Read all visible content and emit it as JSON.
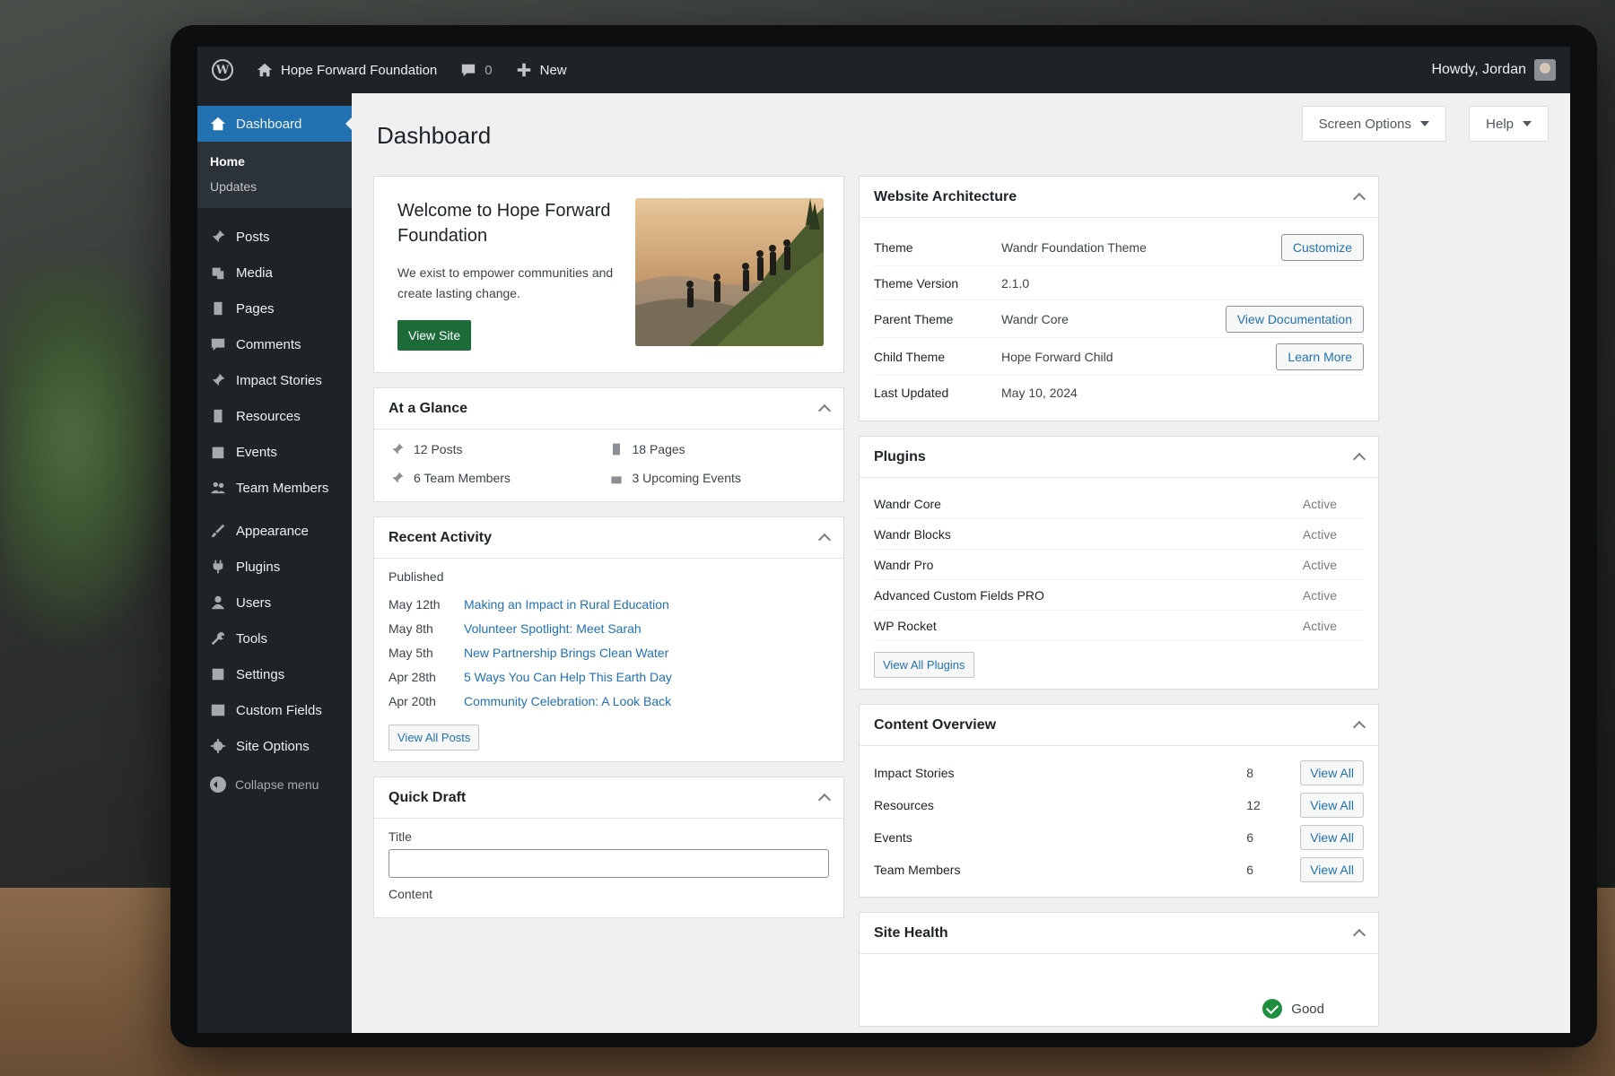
{
  "adminbar": {
    "site_name": "Hope Forward Foundation",
    "comments_count": "0",
    "new_label": "New",
    "greeting": "Howdy, Jordan"
  },
  "sidebar": {
    "dashboard": "Dashboard",
    "sub_home": "Home",
    "sub_updates": "Updates",
    "items": [
      {
        "label": "Posts",
        "icon": "pin-icon"
      },
      {
        "label": "Media",
        "icon": "media-icon"
      },
      {
        "label": "Pages",
        "icon": "pages-icon"
      },
      {
        "label": "Comments",
        "icon": "comments-icon"
      },
      {
        "label": "Impact Stories",
        "icon": "pin-icon"
      },
      {
        "label": "Resources",
        "icon": "pages-icon"
      },
      {
        "label": "Events",
        "icon": "calendar-icon"
      },
      {
        "label": "Team Members",
        "icon": "users-icon"
      }
    ],
    "items2": [
      {
        "label": "Appearance",
        "icon": "brush-icon"
      },
      {
        "label": "Plugins",
        "icon": "plug-icon"
      },
      {
        "label": "Users",
        "icon": "user-icon"
      },
      {
        "label": "Tools",
        "icon": "wrench-icon"
      },
      {
        "label": "Settings",
        "icon": "settings-icon"
      },
      {
        "label": "Custom Fields",
        "icon": "table-icon"
      },
      {
        "label": "Site Options",
        "icon": "gear-icon"
      }
    ],
    "collapse": "Collapse menu"
  },
  "page": {
    "title": "Dashboard",
    "screen_options": "Screen Options",
    "help": "Help"
  },
  "welcome": {
    "title": "Welcome to Hope Forward Foundation",
    "text": "We exist to empower communities and create lasting change.",
    "button": "View Site"
  },
  "glance": {
    "title": "At a Glance",
    "posts": "12 Posts",
    "pages": "18 Pages",
    "team": "6 Team Members",
    "events": "3 Upcoming Events"
  },
  "activity": {
    "title": "Recent Activity",
    "published_label": "Published",
    "rows": [
      {
        "date": "May 12th",
        "title": "Making an Impact in Rural Education"
      },
      {
        "date": "May 8th",
        "title": "Volunteer Spotlight: Meet Sarah"
      },
      {
        "date": "May 5th",
        "title": "New Partnership Brings Clean Water"
      },
      {
        "date": "Apr 28th",
        "title": "5 Ways You Can Help This Earth Day"
      },
      {
        "date": "Apr 20th",
        "title": "Community Celebration: A Look Back"
      }
    ],
    "view_all": "View All Posts"
  },
  "quick_draft": {
    "title": "Quick Draft",
    "title_label": "Title",
    "content_label": "Content"
  },
  "architecture": {
    "title": "Website Architecture",
    "rows": [
      {
        "key": "Theme",
        "value": "Wandr Foundation Theme",
        "button": "Customize"
      },
      {
        "key": "Theme Version",
        "value": "2.1.0",
        "button": ""
      },
      {
        "key": "Parent Theme",
        "value": "Wandr Core",
        "button": "View Documentation"
      },
      {
        "key": "Child Theme",
        "value": "Hope Forward Child",
        "button": "Learn More"
      },
      {
        "key": "Last Updated",
        "value": "May 10, 2024",
        "button": ""
      }
    ]
  },
  "plugins": {
    "title": "Plugins",
    "rows": [
      {
        "name": "Wandr Core",
        "status": "Active"
      },
      {
        "name": "Wandr Blocks",
        "status": "Active"
      },
      {
        "name": "Wandr Pro",
        "status": "Active"
      },
      {
        "name": "Advanced Custom Fields PRO",
        "status": "Active"
      },
      {
        "name": "WP Rocket",
        "status": "Active"
      }
    ],
    "view_all": "View All Plugins"
  },
  "content_overview": {
    "title": "Content Overview",
    "rows": [
      {
        "name": "Impact Stories",
        "count": "8",
        "button": "View All"
      },
      {
        "name": "Resources",
        "count": "12",
        "button": "View All"
      },
      {
        "name": "Events",
        "count": "6",
        "button": "View All"
      },
      {
        "name": "Team Members",
        "count": "6",
        "button": "View All"
      }
    ]
  },
  "site_health": {
    "title": "Site Health",
    "status": "Good"
  },
  "colors": {
    "admin_dark": "#1d2327",
    "accent_blue": "#2271b1",
    "button_green": "#1e6b3a",
    "status_good": "#1e8f3e"
  }
}
